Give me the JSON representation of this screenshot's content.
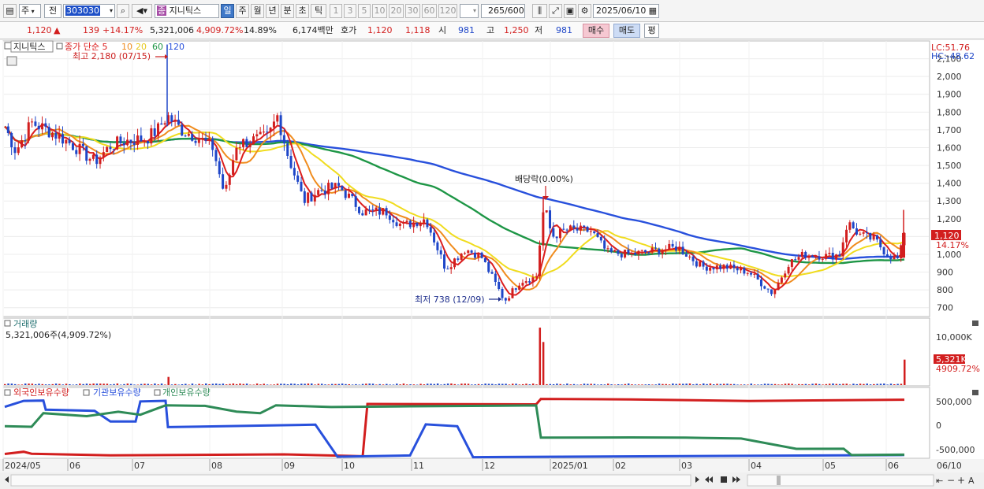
{
  "toolbar": {
    "period_type": "주",
    "market": "전",
    "code": "303030",
    "stock_name": "지니틱스",
    "stock_badge": "종",
    "intervals": [
      "일",
      "주",
      "월",
      "년",
      "분",
      "초",
      "틱"
    ],
    "active_interval": "일",
    "minute_units": [
      "1",
      "3",
      "5",
      "10",
      "20",
      "30",
      "60",
      "120"
    ],
    "count_display": "265",
    "count_total": "/600",
    "date": "2025/06/10"
  },
  "quote": {
    "price": "1,120",
    "arrow": "▲",
    "change": "139",
    "change_pct": "+14.17%",
    "volume": "5,321,006",
    "volume_ratio": "4,909.72%",
    "turnover": "14.89%",
    "amount": "6,174백만",
    "ask_label": "호가",
    "ask": "1,120",
    "bid": "1,118",
    "open_label": "시",
    "open": "981",
    "high_label": "고",
    "high": "1,250",
    "low_label": "저",
    "low": "981",
    "buy_button": "매수",
    "sell_button": "매도",
    "eval_button": "평"
  },
  "price_panel": {
    "name_tag": "지니틱스",
    "ma_title": "종가 단순",
    "ma_periods": [
      "5",
      "10",
      "20",
      "60",
      "120"
    ],
    "ma_colors": [
      "#dc1e1e",
      "#f08c1e",
      "#f0dc1e",
      "#1e9646",
      "#2850dc"
    ],
    "lc": "LC:51.76",
    "hc": "HC:-48.62",
    "high_note": "최고 2,180 (07/15)",
    "low_note": "최저 738 (12/09)",
    "dividend_note": "배당락(0.00%)",
    "last_price_tag": "1,120",
    "last_pct_tag": "14.17%",
    "ticks": [
      "2,100",
      "2,000",
      "1,900",
      "1,800",
      "1,700",
      "1,600",
      "1,500",
      "1,400",
      "1,300",
      "1,200",
      "1,100",
      "1,000",
      "900",
      "800",
      "700"
    ]
  },
  "volume_panel": {
    "title": "거래량",
    "value": "5,321,006주(4,909.72%)",
    "tick": "10,000K",
    "last_tag": "5,321K",
    "last_pct": "4909.72%"
  },
  "holding_panel": {
    "series": [
      {
        "name": "외국인보유수량",
        "color": "#d21e1e"
      },
      {
        "name": "기관보유수량",
        "color": "#2850dc"
      },
      {
        "name": "개인보유수량",
        "color": "#2e8b57"
      }
    ],
    "ticks": [
      "500,000",
      "0",
      "-500,000"
    ]
  },
  "x_axis": [
    "2024/05",
    "06",
    "07",
    "08",
    "09",
    "10",
    "11",
    "12",
    "2025/01",
    "02",
    "03",
    "04",
    "05",
    "06",
    "06/10"
  ],
  "chart_data": [
    {
      "type": "line",
      "title": "지니틱스",
      "ylim": [
        650,
        2200
      ],
      "ma_series": [
        "5",
        "10",
        "20",
        "60",
        "120"
      ],
      "x": [
        "2024/05",
        "06",
        "07",
        "07/15",
        "08",
        "09",
        "10",
        "11",
        "12",
        "12/09",
        "2025/01",
        "02",
        "03",
        "04",
        "05",
        "06",
        "06/10"
      ],
      "series": [
        {
          "name": "종가",
          "values": [
            1700,
            1600,
            1650,
            2180,
            1600,
            1750,
            1300,
            1200,
            900,
            738,
            1150,
            1000,
            950,
            850,
            1150,
            1000,
            1120
          ]
        }
      ]
    },
    {
      "type": "bar",
      "title": "거래량",
      "series": [
        {
          "name": "거래량",
          "values": [
            200,
            300,
            1700,
            300,
            400,
            250,
            200,
            250,
            12000,
            400,
            200,
            150,
            200,
            150,
            5321
          ]
        }
      ]
    },
    {
      "type": "line",
      "series": [
        {
          "name": "외국인보유수량",
          "values": [
            -650000,
            -700000,
            -700000,
            -700000,
            -720000,
            -720000,
            500000,
            500000,
            510000,
            600000,
            600000,
            610000,
            620000,
            630000,
            630000
          ]
        },
        {
          "name": "기관보유수량",
          "values": [
            600000,
            100000,
            600000,
            0,
            0,
            -720000,
            -720000,
            0,
            -720000,
            -720000,
            -720000,
            -720000,
            -720000,
            -720000,
            -720000
          ]
        },
        {
          "name": "개인보유수량",
          "values": [
            200000,
            300000,
            400000,
            350000,
            450000,
            450000,
            450000,
            450000,
            450000,
            -250000,
            -300000,
            -350000,
            -500000,
            -720000,
            -720000
          ]
        }
      ]
    }
  ]
}
